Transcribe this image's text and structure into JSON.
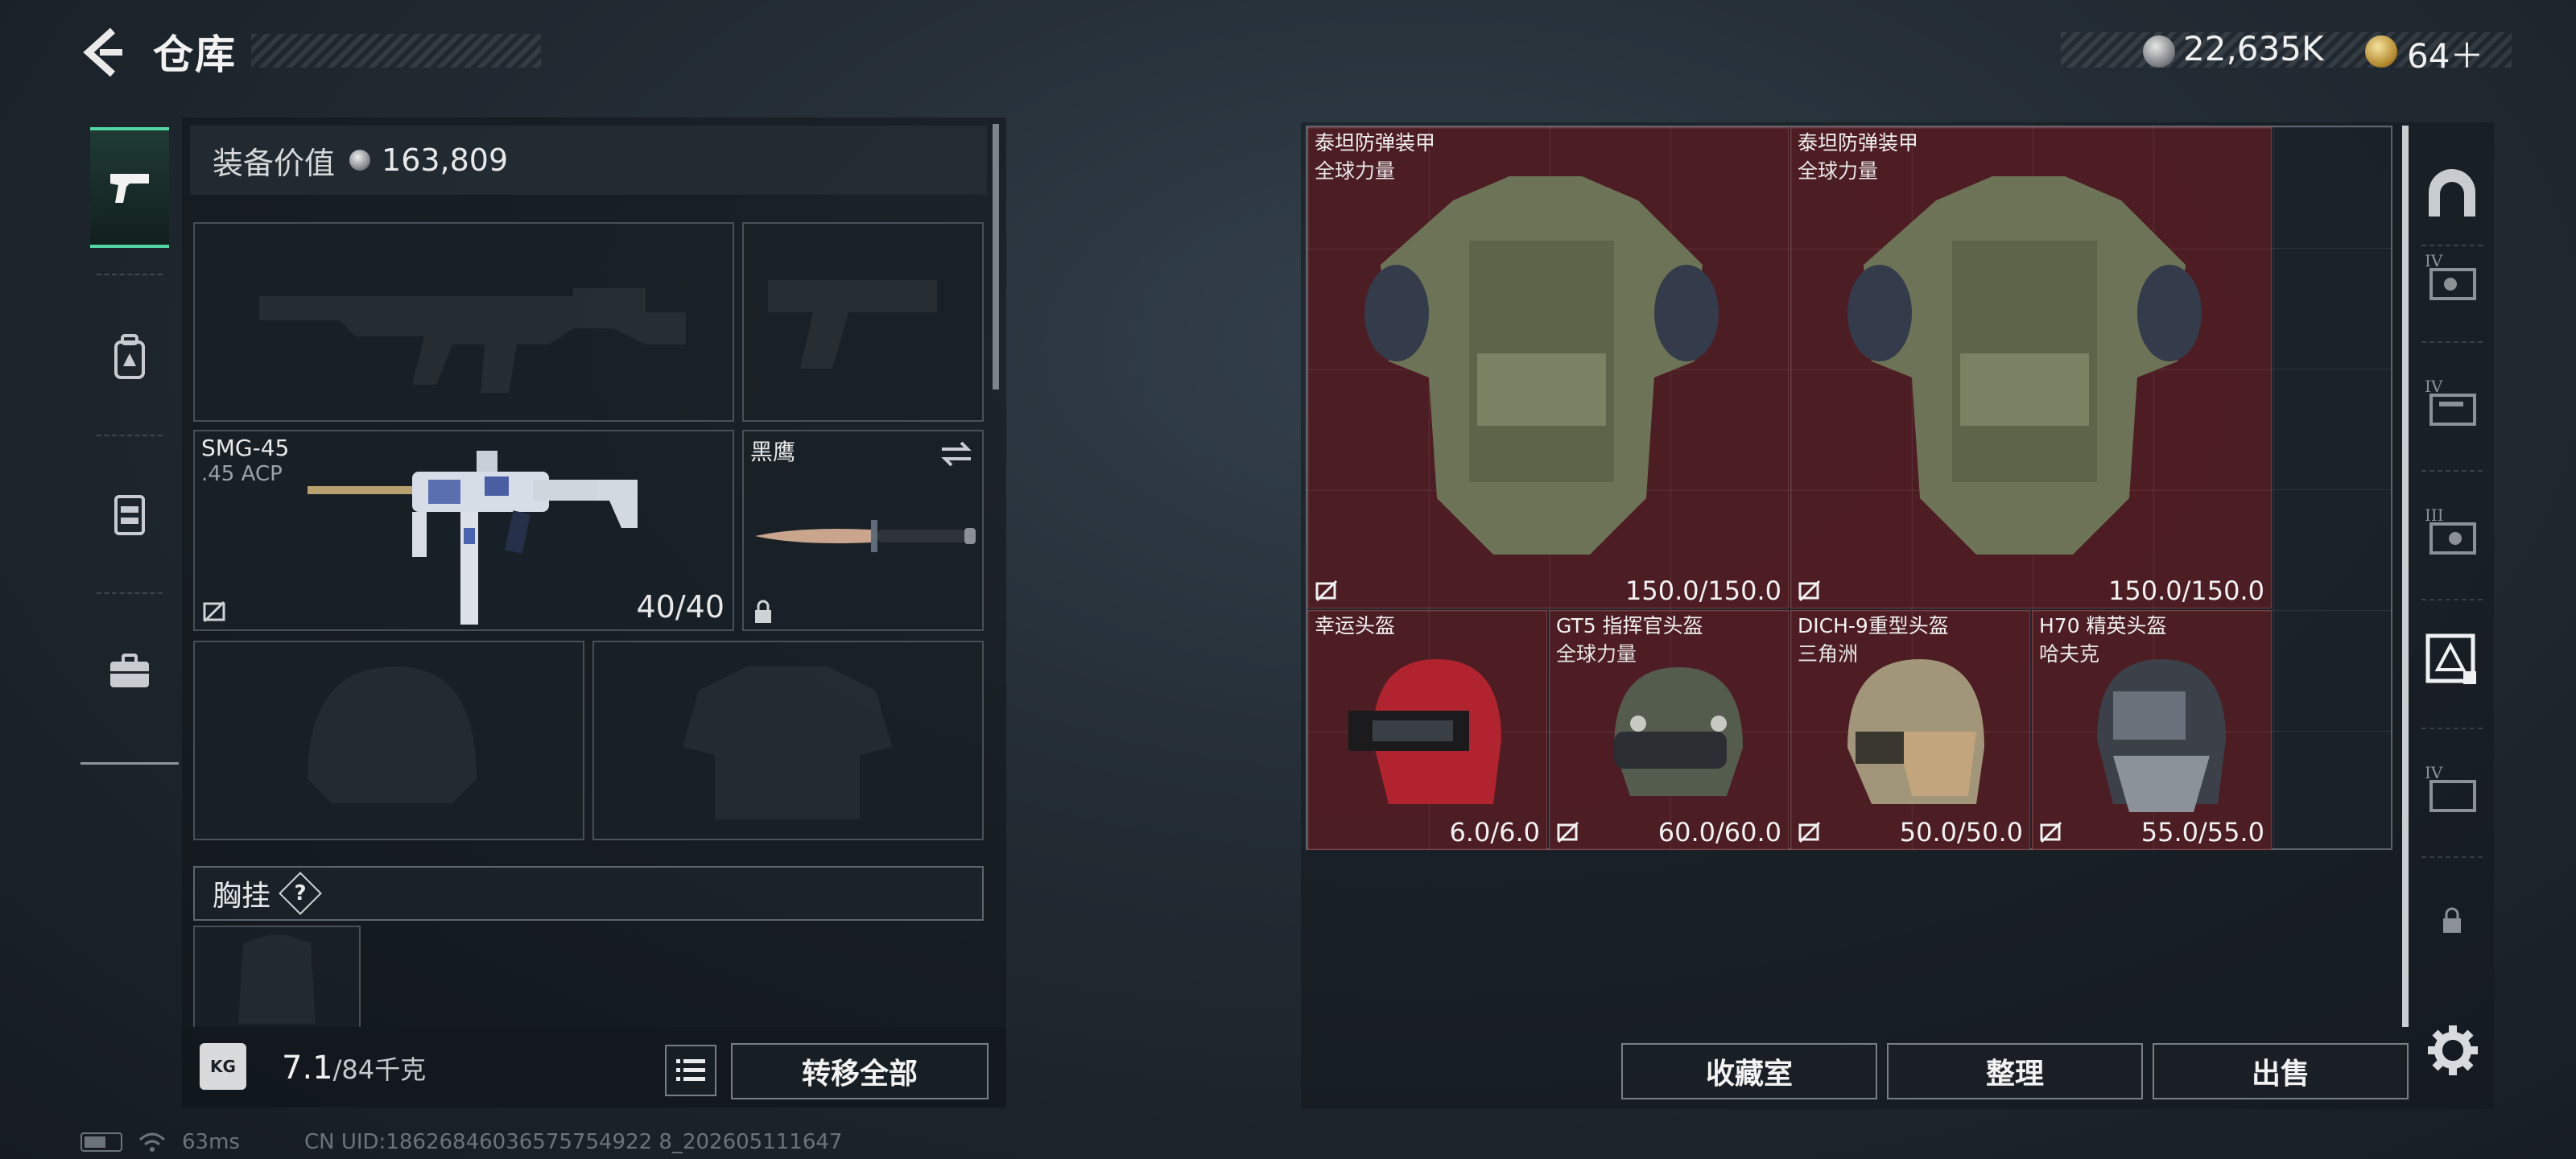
{
  "header": {
    "title": "仓库",
    "currency_silver": "22,635K",
    "currency_gold": "64＋"
  },
  "sidebar": {
    "items": [
      "pistol-icon",
      "backpack-icon",
      "rig-icon",
      "briefcase-icon"
    ],
    "active": "pistol-icon"
  },
  "equipment": {
    "value_label": "装备价值",
    "value": "163,809",
    "primary_weapon": {
      "name": "SMG-45",
      "ammo": ".45 ACP",
      "count": "40/40"
    },
    "melee": {
      "name": "黑鹰"
    },
    "chest_rig_label": "胸挂",
    "chest_rig_help": "?"
  },
  "bottom": {
    "weight": "7.1",
    "weight_max": "/84千克",
    "transfer_all": "转移全部",
    "weight_icon_text": "KG"
  },
  "storage": {
    "items": [
      {
        "name": "泰坦防弹装甲",
        "sub": "全球力量",
        "durability": "150.0/150.0"
      },
      {
        "name": "泰坦防弹装甲",
        "sub": "全球力量",
        "durability": "150.0/150.0"
      },
      {
        "name": "幸运头盔",
        "sub": "",
        "durability": "6.0/6.0"
      },
      {
        "name": "GT5 指挥官头盔",
        "sub": "全球力量",
        "durability": "60.0/60.0"
      },
      {
        "name": "DICH-9重型头盔",
        "sub": "三角洲",
        "durability": "50.0/50.0"
      },
      {
        "name": "H70 精英头盔",
        "sub": "哈夫克",
        "durability": "55.0/55.0"
      }
    ]
  },
  "actions": {
    "collection": "收藏室",
    "sort": "整理",
    "sell": "出售"
  },
  "right_sidebar": {
    "tiers": [
      "IV",
      "IV",
      "III",
      "IV"
    ]
  },
  "status": {
    "ping": "63ms",
    "uid": "CN UID:18626846036575754922 8_202605111647"
  },
  "colors": {
    "accent": "#52d6a2",
    "item_bg": "#581c22"
  }
}
